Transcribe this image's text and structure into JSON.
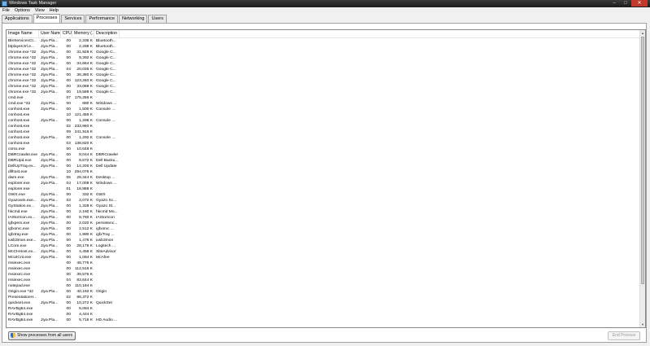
{
  "window": {
    "title": "Windows Task Manager",
    "controls": [
      "–",
      "□",
      "✕"
    ]
  },
  "menu": [
    "File",
    "Options",
    "View",
    "Help"
  ],
  "tabs": [
    {
      "label": "Applications",
      "active": false
    },
    {
      "label": "Processes",
      "active": true
    },
    {
      "label": "Services",
      "active": false
    },
    {
      "label": "Performance",
      "active": false
    },
    {
      "label": "Networking",
      "active": false
    },
    {
      "label": "Users",
      "active": false
    }
  ],
  "columns": [
    "Image Name",
    "User Name",
    "CPU",
    "Memory (...",
    "Description"
  ],
  "processes": [
    [
      "BleServicesCt...",
      "Jiya Pla...",
      "00",
      "2,336 K",
      "Bluetooth..."
    ],
    [
      "btplayerctrl.e...",
      "Jiya Pla...",
      "00",
      "2,288 K",
      "Bluetooth..."
    ],
    [
      "chrome.exe *32",
      "Jiya Pla...",
      "00",
      "31,928 K",
      "Google C..."
    ],
    [
      "chrome.exe *32",
      "Jiya Pla...",
      "00",
      "9,392 K",
      "Google C..."
    ],
    [
      "chrome.exe *32",
      "Jiya Pla...",
      "00",
      "34,664 K",
      "Google C..."
    ],
    [
      "chrome.exe *32",
      "Jiya Pla...",
      "04",
      "20,036 K",
      "Google C..."
    ],
    [
      "chrome.exe *32",
      "Jiya Pla...",
      "00",
      "36,380 K",
      "Google C..."
    ],
    [
      "chrome.exe *32",
      "Jiya Pla...",
      "00",
      "123,260 K",
      "Google C..."
    ],
    [
      "chrome.exe *32",
      "Jiya Pla...",
      "00",
      "33,088 K",
      "Google C..."
    ],
    [
      "chrome.exe *32",
      "Jiya Pla...",
      "00",
      "19,588 K",
      "Google C..."
    ],
    [
      "cmd.exe",
      "",
      "07",
      "175,256 K",
      ""
    ],
    [
      "cmd.exe *32",
      "Jiya Pla...",
      "00",
      "880 K",
      "Windows ..."
    ],
    [
      "conhost.exe",
      "Jiya Pla...",
      "00",
      "1,500 K",
      "Console ..."
    ],
    [
      "conhost.exe",
      "",
      "10",
      "121,456 K",
      ""
    ],
    [
      "conhost.exe",
      "Jiya Pla...",
      "00",
      "1,296 K",
      "Console ..."
    ],
    [
      "conhost.exe",
      "",
      "02",
      "233,960 K",
      ""
    ],
    [
      "conhost.exe",
      "",
      "09",
      "241,916 K",
      ""
    ],
    [
      "conhost.exe",
      "Jiya Pla...",
      "00",
      "1,292 K",
      "Console ..."
    ],
    [
      "conhost.exe",
      "",
      "03",
      "138,820 K",
      ""
    ],
    [
      "csrss.exe",
      "",
      "00",
      "10,648 K",
      ""
    ],
    [
      "DBRCrawler.exe",
      "Jiya Pla...",
      "00",
      "8,044 K",
      "DBRCrawler"
    ],
    [
      "DBRUpd.exe",
      "Jiya Pla...",
      "00",
      "8,672 K",
      "Dell Backu..."
    ],
    [
      "DellUpTray.ex...",
      "Jiya Pla...",
      "00",
      "14,200 K",
      "Dell Update"
    ],
    [
      "dllhost.exe",
      "",
      "10",
      "294,076 K",
      ""
    ],
    [
      "dwm.exe",
      "Jiya Pla...",
      "05",
      "28,344 K",
      "Desktop ..."
    ],
    [
      "explorer.exe",
      "Jiya Pla...",
      "04",
      "17,008 K",
      "Windows ..."
    ],
    [
      "explorer.exe",
      "",
      "01",
      "18,888 K",
      ""
    ],
    [
      "GWX.exe",
      "Jiya Pla...",
      "00",
      "332 K",
      "GWX"
    ],
    [
      "Gyazowin.exe...",
      "Jiya Pla...",
      "03",
      "2,072 K",
      "Gyazo Sc..."
    ],
    [
      "GyStation.ex...",
      "Jiya Pla...",
      "00",
      "1,328 K",
      "Gyazo St..."
    ],
    [
      "hkcmd.exe",
      "Jiya Pla...",
      "00",
      "2,160 K",
      "hkcmd Mo..."
    ],
    [
      "IAStorIcon.ex...",
      "Jiya Pla...",
      "00",
      "8,760 K",
      "IAStorIcon"
    ],
    [
      "igfxpers.exe",
      "Jiya Pla...",
      "00",
      "2,020 K",
      "persistenc..."
    ],
    [
      "igfxsrvc.exe",
      "Jiya Pla...",
      "00",
      "2,512 K",
      "igfxsrvc ..."
    ],
    [
      "igfxtray.exe",
      "Jiya Pla...",
      "00",
      "1,980 K",
      "igfxTray ..."
    ],
    [
      "iusb3mon.exe...",
      "Jiya Pla...",
      "00",
      "1,476 K",
      "iusb3mon"
    ],
    [
      "LCore.exe",
      "Jiya Pla...",
      "00",
      "28,176 K",
      "Logitech ..."
    ],
    [
      "McCHHost.ex...",
      "Jiya Pla...",
      "00",
      "4,456 K",
      "SiteAdvisor"
    ],
    [
      "McUICnt.exe",
      "Jiya Pla...",
      "00",
      "1,064 K",
      "McAfee"
    ],
    [
      "msiexec.exe",
      "",
      "00",
      "46,776 K",
      ""
    ],
    [
      "msiexec.exe",
      "",
      "00",
      "112,516 K",
      ""
    ],
    [
      "msiexec.exe",
      "",
      "00",
      "39,576 K",
      ""
    ],
    [
      "msiexec.exe",
      "",
      "04",
      "83,644 K",
      ""
    ],
    [
      "notepad.exe",
      "",
      "00",
      "110,184 K",
      ""
    ],
    [
      "Origin.exe *32",
      "Jiya Pla...",
      "00",
      "40,192 K",
      "Origin"
    ],
    [
      "PresentationH...",
      "",
      "02",
      "86,372 K",
      ""
    ],
    [
      "quickset.exe",
      "Jiya Pla...",
      "00",
      "10,272 K",
      "QuickSet"
    ],
    [
      "RAVBg64.exe",
      "",
      "00",
      "5,084 K",
      ""
    ],
    [
      "RAVBg64.exe",
      "",
      "00",
      "4,444 K",
      ""
    ],
    [
      "RAVBg64.exe",
      "Jiya Pla...",
      "00",
      "5,716 K",
      "HD Audio ..."
    ]
  ],
  "buttons": {
    "show_all": "Show processes from all users",
    "end_process": "End Process"
  }
}
